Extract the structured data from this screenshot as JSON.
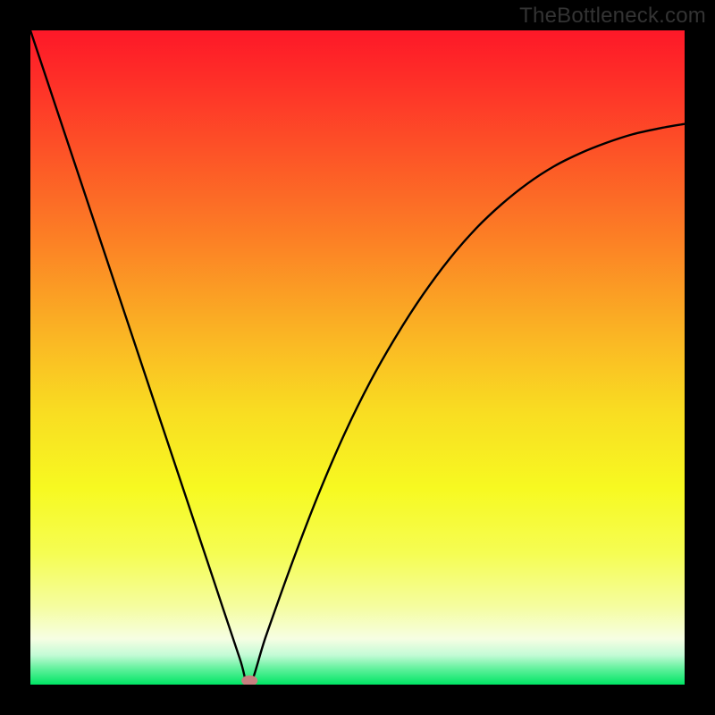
{
  "watermark": "TheBottleneck.com",
  "chart_data": {
    "type": "line",
    "title": "",
    "xlabel": "",
    "ylabel": "",
    "xlim": [
      0,
      1
    ],
    "ylim": [
      0,
      1
    ],
    "series": [
      {
        "name": "curve",
        "color": "#000000",
        "x": [
          0.0,
          0.04,
          0.08,
          0.12,
          0.16,
          0.2,
          0.24,
          0.28,
          0.32,
          0.335,
          0.36,
          0.4,
          0.44,
          0.48,
          0.52,
          0.56,
          0.6,
          0.64,
          0.68,
          0.72,
          0.76,
          0.8,
          0.84,
          0.88,
          0.92,
          0.96,
          1.0
        ],
        "y": [
          1.0,
          0.88,
          0.76,
          0.64,
          0.52,
          0.4,
          0.28,
          0.16,
          0.04,
          0.0,
          0.074,
          0.186,
          0.29,
          0.383,
          0.464,
          0.534,
          0.596,
          0.65,
          0.696,
          0.734,
          0.766,
          0.792,
          0.812,
          0.828,
          0.841,
          0.85,
          0.857
        ]
      }
    ],
    "marker": {
      "x": 0.335,
      "y": 0.006,
      "color": "#c78080"
    },
    "gradient_stops": [
      {
        "offset": 0.0,
        "color": "#fd1828"
      },
      {
        "offset": 0.07,
        "color": "#fe2d28"
      },
      {
        "offset": 0.18,
        "color": "#fd5127"
      },
      {
        "offset": 0.32,
        "color": "#fc8025"
      },
      {
        "offset": 0.46,
        "color": "#fab324"
      },
      {
        "offset": 0.58,
        "color": "#f9dc22"
      },
      {
        "offset": 0.7,
        "color": "#f7f921"
      },
      {
        "offset": 0.8,
        "color": "#f5fd53"
      },
      {
        "offset": 0.88,
        "color": "#f5fd9f"
      },
      {
        "offset": 0.93,
        "color": "#f6fee3"
      },
      {
        "offset": 0.955,
        "color": "#c3fbd6"
      },
      {
        "offset": 0.975,
        "color": "#64f19e"
      },
      {
        "offset": 1.0,
        "color": "#00e564"
      }
    ]
  }
}
